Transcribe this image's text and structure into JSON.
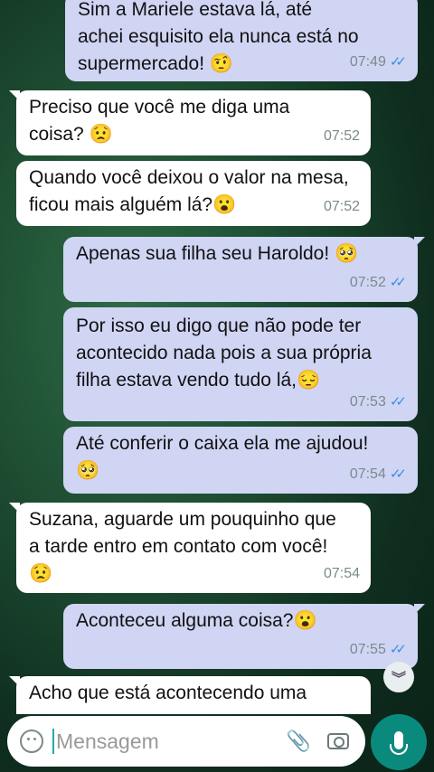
{
  "messages": [
    {
      "dir": "sent",
      "lines": [
        "Sim a Mariele estava lá, até",
        "achei esquisito ela nunca está no",
        "supermercado! 🤨"
      ],
      "time": "07:49"
    },
    {
      "dir": "recv",
      "lines": [
        "Preciso que você me diga uma",
        "coisa? 😟"
      ],
      "time": "07:52"
    },
    {
      "dir": "recv",
      "lines": [
        "Quando você deixou o valor na mesa,",
        "ficou mais alguém lá?😮"
      ],
      "time": "07:52"
    },
    {
      "dir": "sent",
      "lines": [
        "Apenas sua filha seu Haroldo! 🥺"
      ],
      "time": "07:52"
    },
    {
      "dir": "sent",
      "lines": [
        "Por isso eu digo que não pode ter",
        "acontecido nada pois a sua própria",
        "filha estava vendo tudo lá,😔"
      ],
      "time": "07:53"
    },
    {
      "dir": "sent",
      "lines": [
        "Até conferir o caixa ela me ajudou!",
        "🥺"
      ],
      "time": "07:54"
    },
    {
      "dir": "recv",
      "lines": [
        "Suzana, aguarde um pouquinho que",
        "a tarde entro em contato com você!",
        "😟"
      ],
      "time": "07:54"
    },
    {
      "dir": "sent",
      "lines": [
        "Aconteceu alguma coisa?😮"
      ],
      "time": "07:55"
    },
    {
      "dir": "recv",
      "lines": [
        "Acho que está acontecendo uma"
      ],
      "time": ""
    }
  ],
  "input": {
    "placeholder": "Mensagem"
  },
  "icons": {
    "emoji": "emoji-icon",
    "attach": "paperclip-icon",
    "camera": "camera-icon",
    "mic": "mic-icon",
    "scroll": "chevron-double-down-icon"
  },
  "colors": {
    "sent_bubble": "#d0d5f4",
    "recv_bubble": "#ffffff",
    "read_check": "#3b8fe0",
    "mic_button": "#0a8a7c"
  }
}
